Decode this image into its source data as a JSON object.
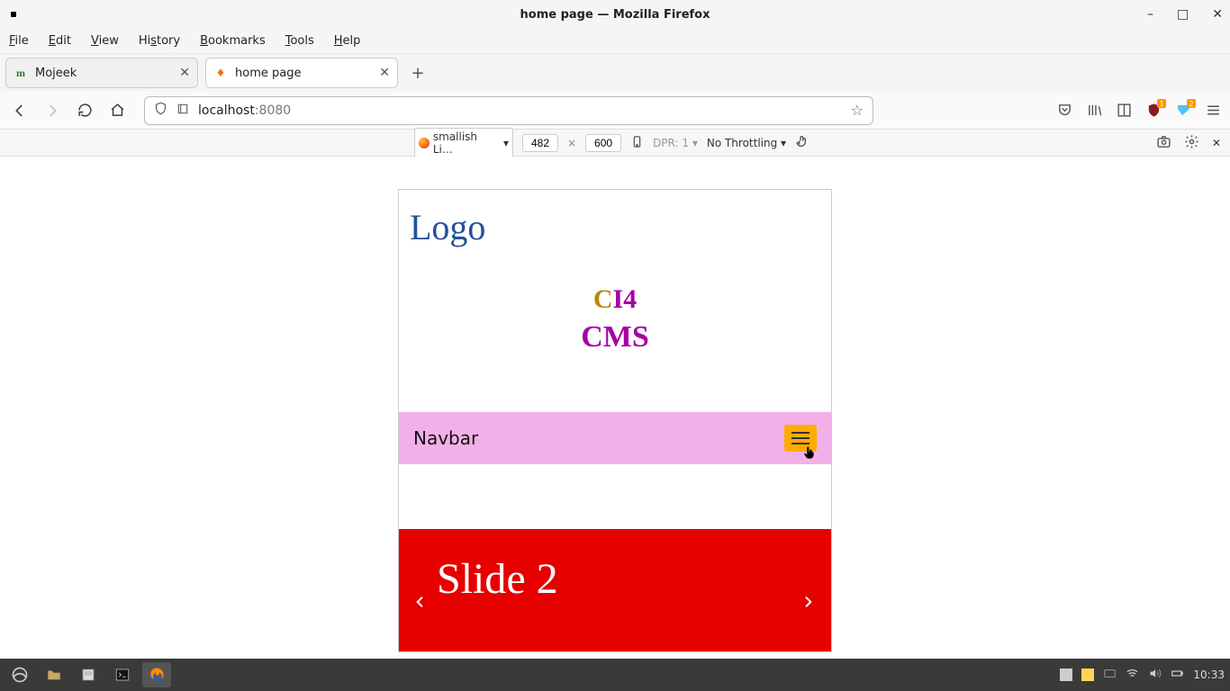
{
  "window": {
    "title": "home page — Mozilla Firefox"
  },
  "menu": {
    "file": "File",
    "edit": "Edit",
    "view": "View",
    "history": "History",
    "bookmarks": "Bookmarks",
    "tools": "Tools",
    "help": "Help"
  },
  "tabs": [
    {
      "title": "Mojeek",
      "active": false
    },
    {
      "title": "home page",
      "active": true
    }
  ],
  "url": {
    "host": "localhost",
    "port": ":8080"
  },
  "rdm": {
    "device": "smallish Li…",
    "width": "482",
    "height": "600",
    "dpr": "DPR: 1",
    "throttling": "No Throttling"
  },
  "page": {
    "logo": "Logo",
    "hero_line1_c": "C",
    "hero_line1_rest": "I4",
    "hero_line2": "CMS",
    "navbar_brand": "Navbar",
    "slide_title": "Slide 2"
  },
  "ublock_badge": "1",
  "bell_badge": "2",
  "clock": "10:33"
}
